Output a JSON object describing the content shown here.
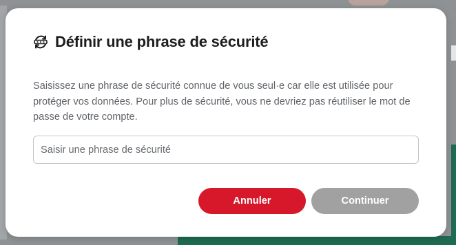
{
  "dialog": {
    "icon": "password-mask-refresh-icon",
    "title": "Définir une phrase de sécurité",
    "description": "Saisissez une phrase de sécurité connue de vous seul·e car elle est utilisée pour protéger vos données. Pour plus de sécurité, vous ne devriez pas réutiliser le mot de passe de votre compte.",
    "input": {
      "placeholder": "Saisir une phrase de sécurité",
      "value": ""
    },
    "buttons": {
      "cancel_label": "Annuler",
      "continue_label": "Continuer"
    }
  },
  "colors": {
    "accent": "#d7182a",
    "disabled_button": "#a1a1a1",
    "overlay": "#8f9294"
  }
}
